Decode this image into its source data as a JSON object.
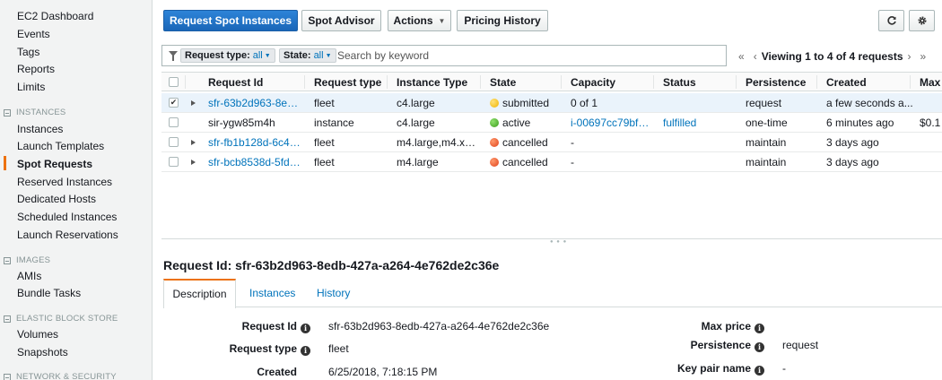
{
  "sidebar": {
    "top_items": [
      "EC2 Dashboard",
      "Events",
      "Tags",
      "Reports",
      "Limits"
    ],
    "sections": [
      {
        "title": "INSTANCES",
        "items": [
          "Instances",
          "Launch Templates",
          "Spot Requests",
          "Reserved Instances",
          "Dedicated Hosts",
          "Scheduled Instances",
          "Launch Reservations"
        ]
      },
      {
        "title": "IMAGES",
        "items": [
          "AMIs",
          "Bundle Tasks"
        ]
      },
      {
        "title": "ELASTIC BLOCK STORE",
        "items": [
          "Volumes",
          "Snapshots"
        ]
      },
      {
        "title": "NETWORK & SECURITY",
        "items": []
      }
    ],
    "active_item": "Spot Requests"
  },
  "toolbar": {
    "request_spot_label": "Request Spot Instances",
    "spot_advisor_label": "Spot Advisor",
    "actions_label": "Actions",
    "pricing_history_label": "Pricing History"
  },
  "filter": {
    "request_type_key": "Request type:",
    "request_type_value": "all",
    "state_key": "State:",
    "state_value": "all",
    "search_placeholder": "Search by keyword"
  },
  "pager": {
    "text": "Viewing 1 to 4 of 4 requests"
  },
  "table": {
    "columns": [
      "Request Id",
      "Request type",
      "Instance Type",
      "State",
      "Capacity",
      "Status",
      "Persistence",
      "Created",
      "Max"
    ],
    "rows": [
      {
        "id": "sfr-63b2d963-8edb...",
        "type": "fleet",
        "instance_type": "c4.large",
        "state": "submitted",
        "state_color": "yellow",
        "capacity": "0 of 1",
        "status": "",
        "persistence": "request",
        "created": "a few seconds a...",
        "max": "",
        "selected": true,
        "expandable": true
      },
      {
        "id": "sir-ygw85m4h",
        "type": "instance",
        "instance_type": "c4.large",
        "state": "active",
        "state_color": "green",
        "capacity": "i-00697cc79bf1...",
        "status": "fulfilled",
        "persistence": "one-time",
        "created": "6 minutes ago",
        "max": "$0.1",
        "selected": false,
        "expandable": false
      },
      {
        "id": "sfr-fb1b128d-6c4b-...",
        "type": "fleet",
        "instance_type": "m4.large,m4.xla...",
        "state": "cancelled",
        "state_color": "red",
        "capacity": "-",
        "status": "",
        "persistence": "maintain",
        "created": "3 days ago",
        "max": "",
        "selected": false,
        "expandable": true
      },
      {
        "id": "sfr-bcb8538d-5fd3-...",
        "type": "fleet",
        "instance_type": "m4.large",
        "state": "cancelled",
        "state_color": "red",
        "capacity": "-",
        "status": "",
        "persistence": "maintain",
        "created": "3 days ago",
        "max": "",
        "selected": false,
        "expandable": true
      }
    ]
  },
  "detail": {
    "title": "Request Id: sfr-63b2d963-8edb-427a-a264-4e762de2c36e",
    "tabs": [
      "Description",
      "Instances",
      "History"
    ],
    "left_props": [
      {
        "label": "Request Id",
        "value": "sfr-63b2d963-8edb-427a-a264-4e762de2c36e"
      },
      {
        "label": "Request type",
        "value": "fleet"
      },
      {
        "label": "Created",
        "value": "6/25/2018, 7:18:15 PM"
      }
    ],
    "right_props": [
      {
        "label": "Max price",
        "value": ""
      },
      {
        "label": "Persistence",
        "value": "request"
      },
      {
        "label": "Key pair name",
        "value": "-"
      }
    ]
  },
  "colors": {
    "primary": "#1a66b8",
    "link": "#0073bb",
    "accent": "#ec7211"
  },
  "icons": [
    "refresh-icon",
    "gear-icon",
    "filter-icon",
    "info-icon"
  ]
}
